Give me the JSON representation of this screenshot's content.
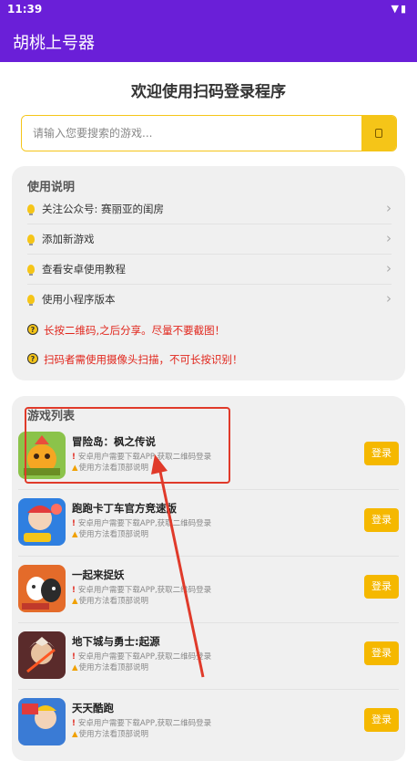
{
  "status": {
    "time": "11:39",
    "icons": "▼▮"
  },
  "app": {
    "title": "胡桃上号器"
  },
  "welcome": "欢迎使用扫码登录程序",
  "search": {
    "placeholder": "请输入您要搜索的游戏...",
    "value": ""
  },
  "instructions": {
    "title": "使用说明",
    "items": [
      {
        "label": "关注公众号: 赛丽亚的闺房"
      },
      {
        "label": "添加新游戏"
      },
      {
        "label": "查看安卓使用教程"
      },
      {
        "label": "使用小程序版本"
      }
    ],
    "warnings": [
      {
        "label": "长按二维码,之后分享。尽量不要截图！"
      },
      {
        "label": "扫码者需使用摄像头扫描，不可长按识别！"
      }
    ]
  },
  "games": {
    "title": "游戏列表",
    "note1": "安卓用户需要下载APP,获取二维码登录",
    "note2": "使用方法看顶部说明",
    "login_label": "登录",
    "items": [
      {
        "name": "冒险岛：枫之传说",
        "icon": "maplestory-game-icon",
        "color": "#8bc34a"
      },
      {
        "name": "跑跑卡丁车官方竞速版",
        "icon": "kartrider-game-icon",
        "color": "#2f7fe0"
      },
      {
        "name": "一起来捉妖",
        "icon": "catch-monster-game-icon",
        "color": "#e46b2a"
      },
      {
        "name": "地下城与勇士:起源",
        "icon": "dnf-origin-game-icon",
        "color": "#5a2b2b"
      },
      {
        "name": "天天酷跑",
        "icon": "daily-parkour-game-icon",
        "color": "#3a7bd5"
      }
    ]
  },
  "colors": {
    "brand": "#6a1fd8",
    "accent": "#f5c518",
    "button": "#f5b800",
    "warning": "#e1261c",
    "annotation": "#e03a2a"
  }
}
